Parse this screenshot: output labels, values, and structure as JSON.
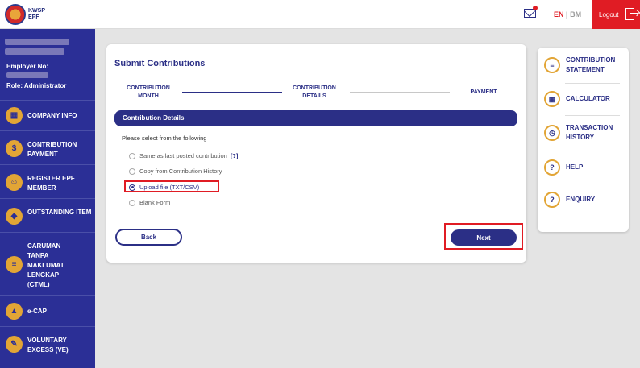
{
  "header": {
    "logo_line1": "KWSP",
    "logo_line2": "EPF",
    "lang_en": "EN",
    "lang_sep": "|",
    "lang_bm": "BM",
    "logout_label": "Logout"
  },
  "sidebar": {
    "employer_label": "Employer No:",
    "role_label": "Role: Administrator",
    "items": [
      {
        "label": "COMPANY INFO",
        "icon": "building-icon"
      },
      {
        "label": "CONTRIBUTION PAYMENT",
        "icon": "coin-icon"
      },
      {
        "label": "REGISTER EPF MEMBER",
        "icon": "user-add-icon"
      },
      {
        "label": "OUTSTANDING ITEM",
        "icon": "money-bag-icon"
      },
      {
        "label": "CARUMAN TANPA MAKLUMAT LENGKAP (CTML)",
        "icon": "document-icon"
      },
      {
        "label": "e-CAP",
        "icon": "cap-icon"
      },
      {
        "label": "VOLUNTARY EXCESS (VE)",
        "icon": "clipboard-icon"
      }
    ]
  },
  "main": {
    "title": "Submit Contributions",
    "steps": [
      {
        "label": "CONTRIBUTION MONTH",
        "active": true
      },
      {
        "label": "CONTRIBUTION DETAILS",
        "active": true
      },
      {
        "label": "PAYMENT",
        "active": false
      }
    ],
    "section_title": "Contribution Details",
    "prompt": "Please select from the following",
    "options": [
      {
        "label": "Same as last posted contribution",
        "selected": false,
        "help": "[?]"
      },
      {
        "label": "Copy from Contribution History",
        "selected": false
      },
      {
        "label": "Upload file (TXT/CSV)",
        "selected": true
      },
      {
        "label": "Blank Form",
        "selected": false
      }
    ],
    "back_label": "Back",
    "next_label": "Next"
  },
  "side_panel": {
    "items": [
      {
        "label": "CONTRIBUTION STATEMENT",
        "icon": "statement-icon"
      },
      {
        "label": "CALCULATOR",
        "icon": "calculator-icon"
      },
      {
        "label": "TRANSACTION HISTORY",
        "icon": "history-icon"
      },
      {
        "label": "HELP",
        "icon": "help-book-icon"
      },
      {
        "label": "ENQUIRY",
        "icon": "enquiry-icon"
      }
    ]
  },
  "colors": {
    "brand_navy": "#2b2f86",
    "sidebar_bg": "#2b2f96",
    "accent_gold": "#e2a536",
    "alert_red": "#e01c24"
  }
}
